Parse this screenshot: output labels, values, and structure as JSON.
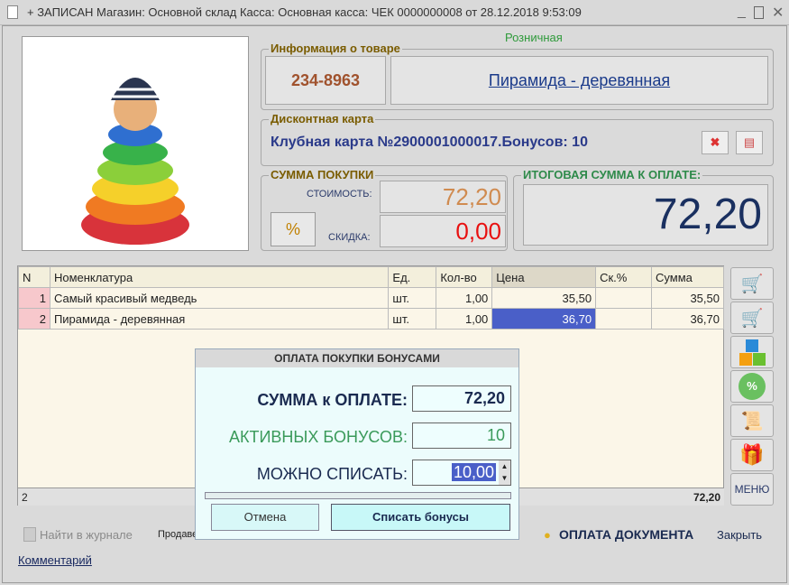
{
  "window": {
    "title": "+ ЗАПИСАН Магазин: Основной склад Касса: Основная касса: ЧЕК 0000000008 от 28.12.2018 9:53:09"
  },
  "price_type": "Розничная",
  "product_info": {
    "label": "Информация о товаре",
    "code": "234-8963",
    "name": "Пирамида - деревянная"
  },
  "discount_card": {
    "label": "Дисконтная карта",
    "text": "Клубная карта №2900001000017.Бонусов: 10"
  },
  "purchase_sum": {
    "label": "СУММА ПОКУПКИ",
    "cost_label": "СТОИМОСТЬ:",
    "cost": "72,20",
    "discount_label": "СКИДКА:",
    "discount": "0,00"
  },
  "total": {
    "label": "ИТОГОВАЯ СУММА К ОПЛАТЕ:",
    "value": "72,20"
  },
  "table": {
    "headers": [
      "N",
      "Номенклатура",
      "Ед.",
      "Кол-во",
      "Цена",
      "Ск.%",
      "Сумма"
    ],
    "rows": [
      [
        "1",
        "Самый красивый медведь",
        "шт.",
        "1,00",
        "35,50",
        "",
        "35,50"
      ],
      [
        "2",
        "Пирамида - деревянная",
        "шт.",
        "1,00",
        "36,70",
        "",
        "36,70"
      ]
    ],
    "footer": {
      "count": "2",
      "total": "72,20"
    }
  },
  "side_buttons": {
    "menu": "МЕНЮ"
  },
  "dialog": {
    "title": "ОПЛАТА ПОКУПКИ БОНУСАМИ",
    "sum_label": "СУММА к ОПЛАТЕ:",
    "sum": "72,20",
    "active_label": "АКТИВНЫХ БОНУСОВ:",
    "active": "10",
    "writeoff_label": "МОЖНО СПИСАТЬ:",
    "writeoff": "10,00",
    "cancel": "Отмена",
    "confirm": "Списать бонусы"
  },
  "bottom": {
    "find": "Найти в журнале",
    "seller": "Продавец",
    "pay": "ОПЛАТА ДОКУМЕНТА",
    "close": "Закрыть",
    "comment": "Комментарий"
  }
}
